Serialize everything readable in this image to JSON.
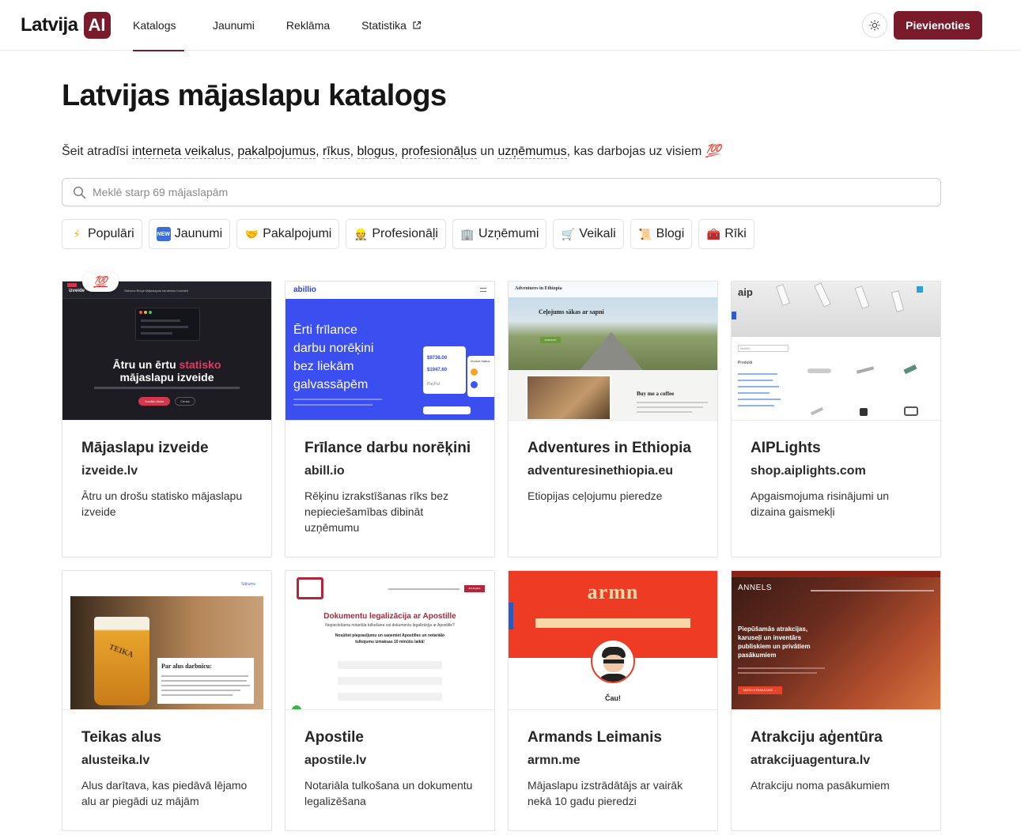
{
  "brand": {
    "name": "Latvija",
    "badge": "AI"
  },
  "nav": [
    {
      "label": "Katalogs",
      "active": true
    },
    {
      "label": "Jaunumi"
    },
    {
      "label": "Reklāma"
    },
    {
      "label": "Statistika",
      "external": true
    }
  ],
  "header": {
    "join_label": "Pievienoties"
  },
  "page": {
    "title": "Latvijas mājaslapu katalogs",
    "subtitle": {
      "intro": "Šeit atradīsi",
      "links": [
        "interneta veikalus",
        "pakalpojumus",
        "rīkus",
        "blogus",
        "profesionāļus",
        "uzņēmumus"
      ],
      "tail": "kas darbojas uz visiem",
      "emoji": "💯"
    }
  },
  "search": {
    "placeholder": "Meklē starp 69 mājaslapām",
    "value": ""
  },
  "chips": [
    {
      "label": "Populāri",
      "icon": "lightning-icon",
      "glyph": "⚡"
    },
    {
      "label": "Jaunumi",
      "icon": "new-icon",
      "glyph": "NEW"
    },
    {
      "label": "Pakalpojumi",
      "icon": "handshake-icon",
      "glyph": "🤝"
    },
    {
      "label": "Profesionāļi",
      "icon": "professional-icon",
      "glyph": "👷"
    },
    {
      "label": "Uzņēmumi",
      "icon": "office-building-icon",
      "glyph": "🏢"
    },
    {
      "label": "Veikali",
      "icon": "shopping-cart-icon",
      "glyph": "🛒"
    },
    {
      "label": "Blogi",
      "icon": "scroll-icon",
      "glyph": "📜"
    },
    {
      "label": "Rīki",
      "icon": "toolbox-icon",
      "glyph": "🧰"
    }
  ],
  "featured_badge": "💯",
  "cards": [
    {
      "title": "Mājaslapu izveide",
      "domain": "izveide.lv",
      "desc": "Ātru un drošu statisko mājaslapu izveide",
      "shot": {
        "logo": "izveide",
        "menu": "Sākums  Blogs  Mājaslapas sarakstos  Kontakti",
        "headline1": "Ātru un ērtu",
        "accent": "statisko",
        "headline2": "mājaslapu izveide",
        "cta": "Uzsākt vārda",
        "cta2": "Cenas"
      }
    },
    {
      "title": "Frīlance darbu norēķini",
      "domain": "abill.io",
      "desc": "Rēķinu izrakstīšanas rīks bez nepieciešamības dibināt uzņēmumu",
      "shot": {
        "logo": "abillio",
        "headline": "Ērti frīlance darbu norēķini bez liekām galvassāpēm",
        "amount1": "$9738.00",
        "amount2": "$1947.60",
        "label": "Invoice status",
        "paypal": "PayPal"
      }
    },
    {
      "title": "Adventures in Ethiopia",
      "domain": "adventuresinethiopia.eu",
      "desc": "Etiopijas ceļojumu pieredze",
      "shot": {
        "site": "Adventures in Ethiopia",
        "headline": "Ceļojums sākas ar sapni",
        "btn": "KONTAKTI",
        "coffee": "Buy me a coffee"
      }
    },
    {
      "title": "AIPLights",
      "domain": "shop.aiplights.com",
      "desc": "Apgaismojuma risinājumi un dizaina gaismekļi",
      "shot": {
        "logo": "aip",
        "products": "Produkti",
        "search": "Meklēt"
      }
    },
    {
      "title": "Teikas alus",
      "domain": "alusteika.lv",
      "desc": "Alus darītava, kas piedāvā lējamo alu ar piegādi uz mājām",
      "shot": {
        "nav": "Sākums",
        "label": "Par alus darbnīcu:",
        "brand": "TEIKA"
      }
    },
    {
      "title": "Apostile",
      "domain": "apostile.lv",
      "desc": "Notariāla tulkošana un dokumentu legalizēšana",
      "shot": {
        "heading": "Dokumentu legalizācija ar Apostille",
        "sub": "Nepieciešama notariāla tulkošana vai dokumentu legalizācija ar Apostille?",
        "step": "Nosūtiet pieprasījumu un saņemiet Apostilles un notariālo tulkojumu izmaksas 10 minūšu laikā!",
        "lang": "EN English"
      }
    },
    {
      "title": "Armands Leimanis",
      "domain": "armn.me",
      "desc": "Mājaslapu izstrādātājs ar vairāk nekā 10 gadu pieredzi",
      "shot": {
        "logo": "armn",
        "hello": "Čau!"
      }
    },
    {
      "title": "Atrakciju aģentūra",
      "domain": "atrakcijuagentura.lv",
      "desc": "Atrakciju noma pasākumiem",
      "shot": {
        "logo": "ANNELS",
        "headline": "Piepūšamās atrakcijas, karuseļi un inventārs publiskiem un privātiem pasākumiem",
        "btn": "MŪSU ATRAKCIJAS →"
      }
    }
  ],
  "colors": {
    "accent": "#7a1b2b",
    "text": "#1f1f1f",
    "border": "#e3e3e3"
  }
}
